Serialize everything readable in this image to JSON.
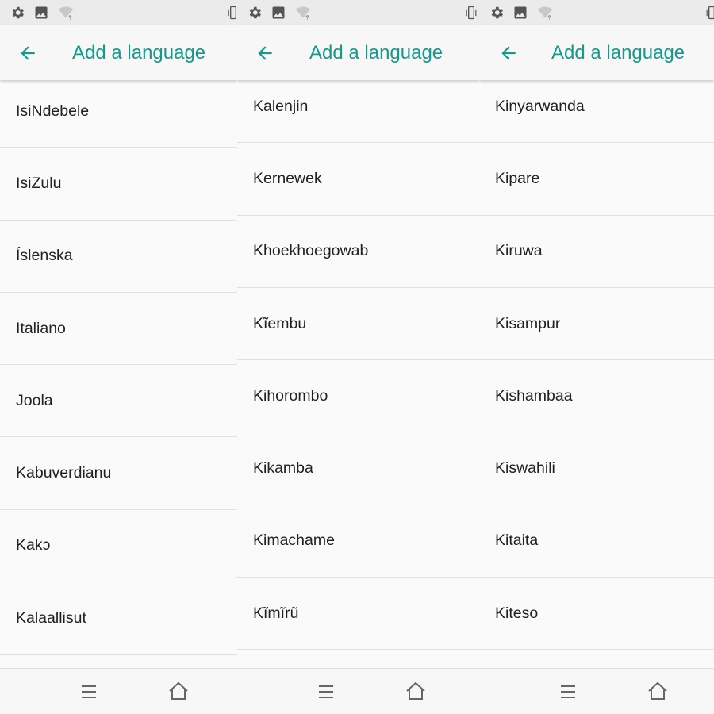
{
  "colors": {
    "accent": "#139a8a",
    "text": "#212121",
    "divider": "#e0e0e0",
    "background": "#fafafa"
  },
  "screens": [
    {
      "title": "Add a language",
      "languages": [
        "IsiNdebele",
        "IsiZulu",
        "Íslenska",
        "Italiano",
        "Joola",
        "Kabuverdianu",
        "Kakɔ",
        "Kalaallisut"
      ]
    },
    {
      "title": "Add a language",
      "languages": [
        "Kalenjin",
        "Kernewek",
        "Khoekhoegowab",
        "Kĩembu",
        "Kihorombo",
        "Kikamba",
        "Kimachame",
        "Kĩmĩrũ"
      ]
    },
    {
      "title": "Add a language",
      "languages": [
        "Kinyarwanda",
        "Kipare",
        "Kiruwa",
        "Kisampur",
        "Kishambaa",
        "Kiswahili",
        "Kitaita",
        "Kiteso"
      ]
    }
  ],
  "icons": {
    "status": [
      "gear-icon",
      "image-icon",
      "wifi-unknown-icon",
      "vibrate-icon"
    ],
    "app_bar": [
      "back-arrow-icon"
    ],
    "nav": [
      "menu-icon",
      "home-icon"
    ]
  }
}
